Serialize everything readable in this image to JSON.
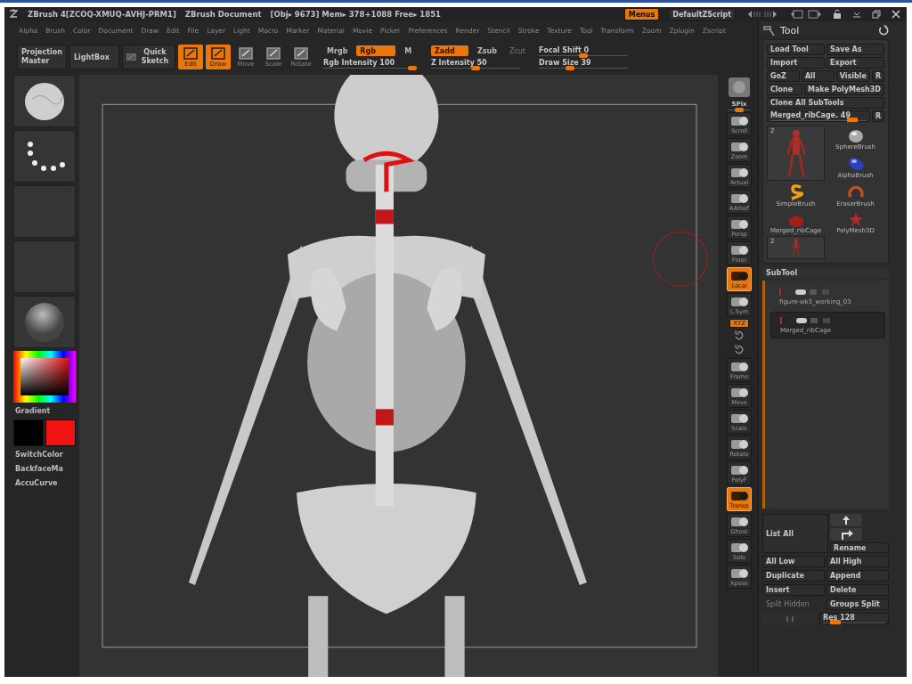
{
  "title_bar": {
    "app": "ZBrush 4[ZCOQ-XMUQ-AVHJ-PRM1]",
    "document": "ZBrush Document",
    "stats": "[Obj▸ 9673] Mem▸ 378+1088 Free▸ 1851",
    "menus": {
      "label": "Menus",
      "on": true
    },
    "script": "DefaultZScript"
  },
  "menu_bar": [
    "Alpha",
    "Brush",
    "Color",
    "Document",
    "Draw",
    "Edit",
    "File",
    "Layer",
    "Light",
    "Macro",
    "Marker",
    "Material",
    "Movie",
    "Picker",
    "Preferences",
    "Render",
    "Stencil",
    "Stroke",
    "Texture",
    "Tool",
    "Transform",
    "Zoom",
    "Zplugin",
    "Zscript"
  ],
  "shelf": {
    "buttons": [
      {
        "label": "Projection Master",
        "kind": "corner"
      },
      {
        "label": "LightBox",
        "kind": "plain"
      },
      {
        "label": "Quick Sketch",
        "kind": "sketch"
      }
    ],
    "modes": [
      {
        "label": "Edit",
        "on": true
      },
      {
        "label": "Draw",
        "on": true
      },
      {
        "label": "Move",
        "on": false
      },
      {
        "label": "Scale",
        "on": false
      },
      {
        "label": "Rotate",
        "on": false
      }
    ],
    "color_group": {
      "toggles": [
        {
          "label": "Mrgb",
          "on": false,
          "disabled": false
        },
        {
          "label": "Rgb",
          "on": true,
          "disabled": false
        },
        {
          "label": "M",
          "on": false,
          "disabled": false
        }
      ],
      "slider": {
        "label": "Rgb Intensity",
        "reading": "100",
        "level": 1.0
      }
    },
    "depth_group": {
      "toggles": [
        {
          "label": "Zadd",
          "on": true,
          "disabled": false
        },
        {
          "label": "Zsub",
          "on": false,
          "disabled": false
        },
        {
          "label": "Zcut",
          "on": false,
          "disabled": true
        }
      ],
      "slider": {
        "label": "Z Intensity",
        "reading": "50",
        "level": 0.5
      }
    },
    "brush_sliders": [
      {
        "label": "Focal Shift",
        "reading": "0",
        "level": 0.5
      },
      {
        "label": "Draw Size",
        "reading": "39",
        "level": 0.35
      }
    ]
  },
  "left_shelf": {
    "thumbnails": [
      {
        "kind": "brush"
      },
      {
        "kind": "stroke"
      },
      {
        "kind": "empty"
      },
      {
        "kind": "empty"
      },
      {
        "kind": "material"
      }
    ],
    "gradient_label": "Gradient",
    "swatches": [
      {
        "color": "#000000"
      },
      {
        "color": "#f01414"
      }
    ],
    "buttons": [
      "SwitchColor",
      "BackfaceMa",
      "AccuCurve"
    ]
  },
  "right_shelf": [
    {
      "kind": "render"
    },
    {
      "kind": "slider",
      "label": "SPix",
      "level": 0.5
    },
    {
      "kind": "button",
      "label": "Scroll",
      "on": false
    },
    {
      "kind": "button",
      "label": "Zoom",
      "on": false
    },
    {
      "kind": "button",
      "label": "Actual",
      "on": false
    },
    {
      "kind": "button",
      "label": "AAHalf",
      "on": false
    },
    {
      "kind": "button",
      "label": "Persp",
      "on": false
    },
    {
      "kind": "button",
      "label": "Floor",
      "on": false
    },
    {
      "kind": "button",
      "label": "Local",
      "on": true
    },
    {
      "kind": "button",
      "label": "L.Sym",
      "on": false
    },
    {
      "kind": "toggle",
      "label": "XYZ",
      "on": true
    },
    {
      "kind": "axis"
    },
    {
      "kind": "axis"
    },
    {
      "kind": "button",
      "label": "Frame",
      "on": false
    },
    {
      "kind": "button",
      "label": "Move",
      "on": false
    },
    {
      "kind": "button",
      "label": "Scale",
      "on": false
    },
    {
      "kind": "button",
      "label": "Rotate",
      "on": false
    },
    {
      "kind": "button",
      "label": "PolyF",
      "on": false
    },
    {
      "kind": "button",
      "label": "Transp",
      "on": true
    },
    {
      "kind": "button",
      "label": "Ghost",
      "on": false
    },
    {
      "kind": "button",
      "label": "Solo",
      "on": false
    },
    {
      "kind": "button",
      "label": "Xpose",
      "on": false
    }
  ],
  "tool_panel": {
    "title": "Tool",
    "rows": [
      [
        {
          "label": "Load Tool"
        },
        {
          "label": "Save As"
        }
      ],
      [
        {
          "label": "Import"
        },
        {
          "label": "Export"
        }
      ],
      [
        {
          "label": "GoZ"
        },
        {
          "label": "All"
        },
        {
          "label": "Visible"
        },
        {
          "label": "R"
        }
      ],
      [
        {
          "label": "Clone"
        },
        {
          "label": "Make PolyMesh3D"
        }
      ],
      [
        {
          "label": "Clone All SubTools"
        }
      ]
    ],
    "current_tool": {
      "label": "Merged_ribCage. 49",
      "level": 0.85,
      "button": "R"
    },
    "tools": [
      {
        "kind": "thumb-large",
        "count": "2"
      },
      {
        "kind": "sphere",
        "label": "SphereBrush"
      },
      {
        "kind": "alpha",
        "label": "AlphaBrush"
      },
      {
        "kind": "simple",
        "label": "SimpleBrush"
      },
      {
        "kind": "eraser",
        "label": "EraserBrush"
      },
      {
        "kind": "mesh",
        "label": "Merged_ribCage"
      },
      {
        "kind": "star",
        "label": "PolyMesh3D"
      },
      {
        "kind": "thumb-small",
        "count": "2"
      }
    ]
  },
  "subtool": {
    "title": "SubTool",
    "items": [
      {
        "label": "figure-wk3_working_03",
        "selected": false
      },
      {
        "label": "Merged_ribCage",
        "selected": true
      }
    ],
    "list_all": "List All",
    "rename": "Rename",
    "rows": [
      [
        {
          "label": "All Low",
          "disabled": false
        },
        {
          "label": "All High",
          "disabled": false
        }
      ],
      [
        {
          "label": "Duplicate",
          "disabled": false
        },
        {
          "label": "Append",
          "disabled": false
        }
      ],
      [
        {
          "label": "Insert",
          "disabled": false
        },
        {
          "label": "Delete",
          "disabled": false
        }
      ],
      [
        {
          "label": "Split Hidden",
          "disabled": true
        },
        {
          "label": "Groups Split",
          "disabled": false
        }
      ]
    ],
    "res": {
      "label": "Res 128",
      "level": 0.2
    }
  }
}
